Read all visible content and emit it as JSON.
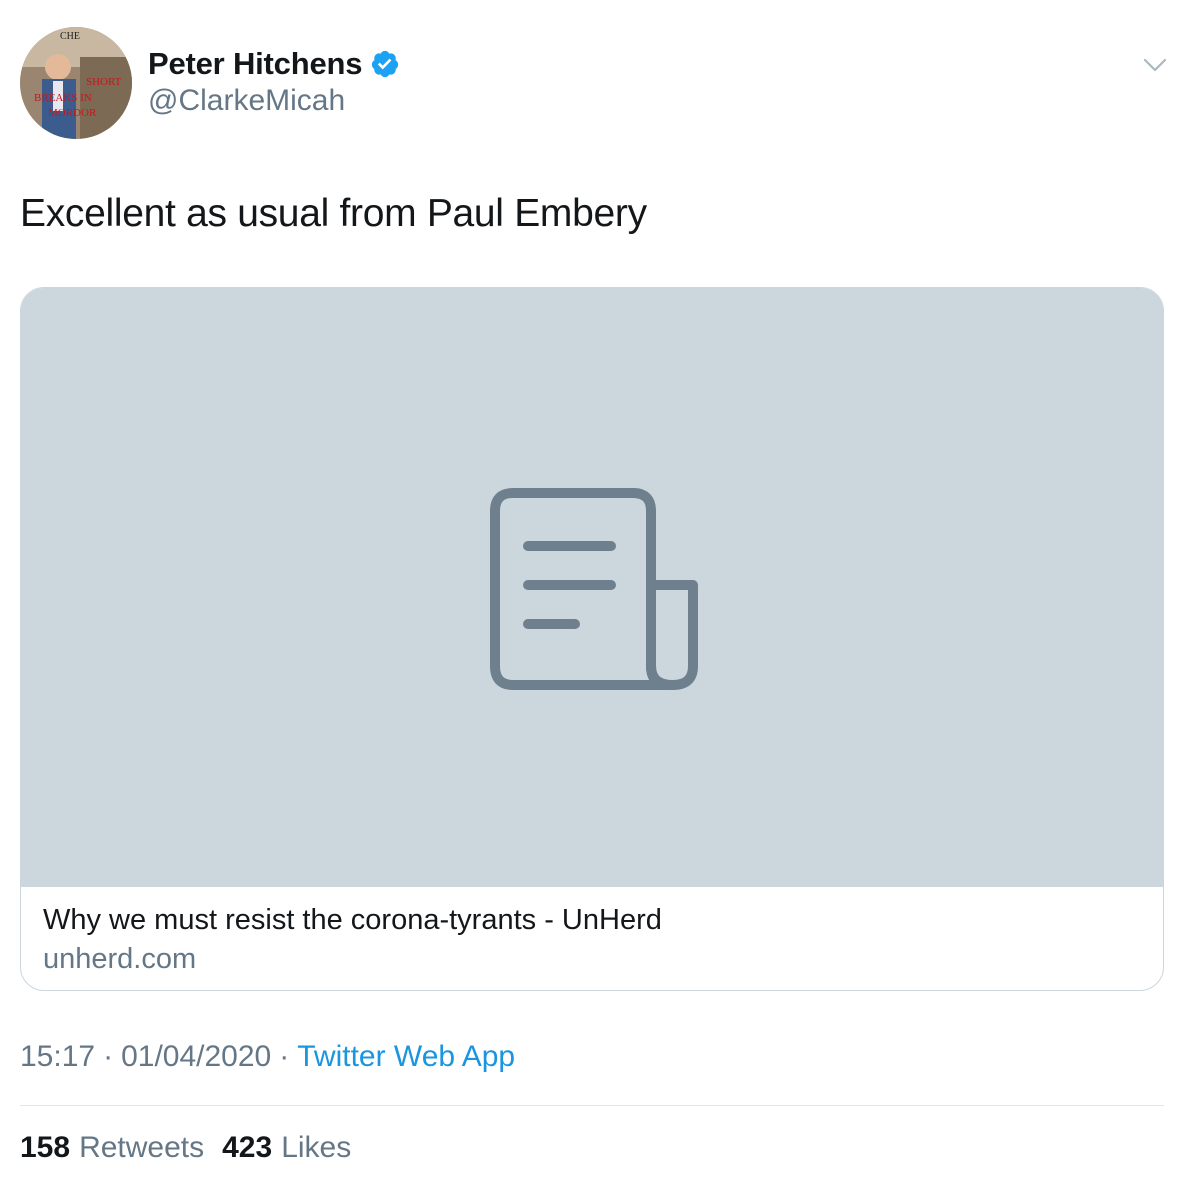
{
  "author": {
    "display_name": "Peter Hitchens",
    "handle": "@ClarkeMicah",
    "verified": true,
    "avatar_lettering": [
      "CHE",
      "SHORT",
      "BREAKS IN",
      "MORDOR"
    ]
  },
  "tweet": {
    "text": "Excellent as usual from Paul Embery"
  },
  "card": {
    "title": "Why we must resist the corona-tyrants - UnHerd",
    "domain": "unherd.com",
    "placeholder_icon": "document-icon"
  },
  "meta": {
    "time": "15:17",
    "separator": "·",
    "date": "01/04/2020",
    "source": "Twitter Web App"
  },
  "stats": {
    "retweets_count": "158",
    "retweets_label": "Retweets",
    "likes_count": "423",
    "likes_label": "Likes"
  },
  "colors": {
    "text_primary": "#14171a",
    "text_secondary": "#657786",
    "link": "#1b95e0",
    "verified": "#1da1f2",
    "card_placeholder": "#ccd6dd",
    "icon_gray": "#6e7f8d",
    "border": "#e1e8ed"
  }
}
